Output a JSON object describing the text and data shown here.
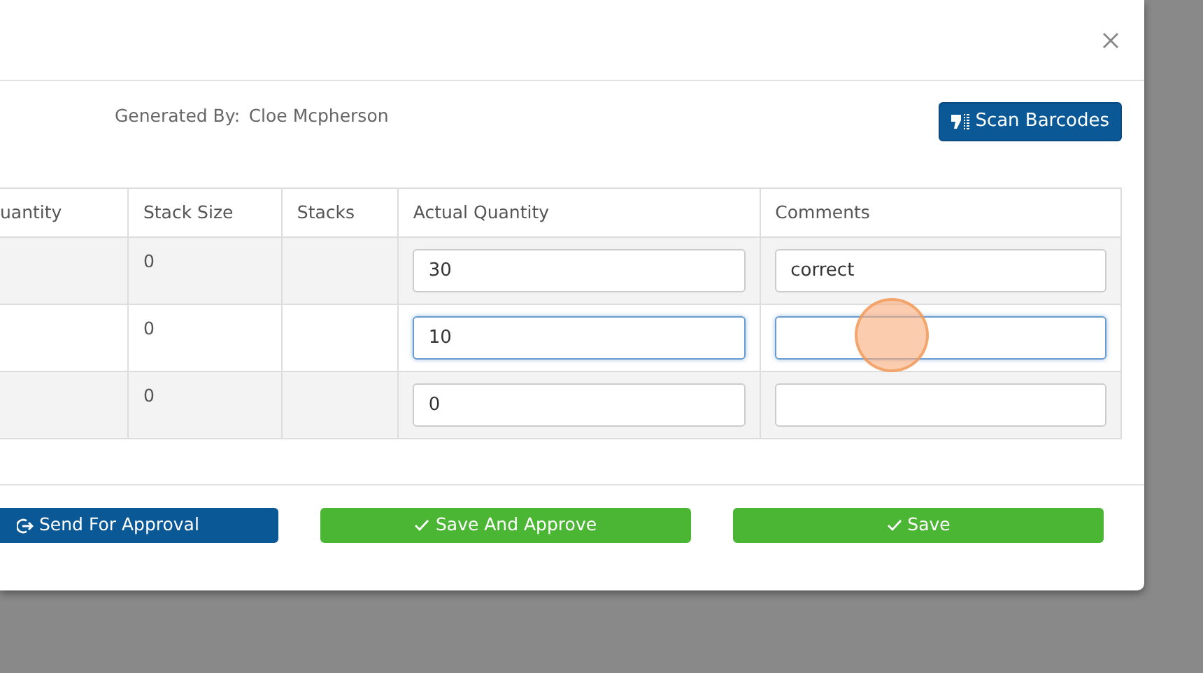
{
  "generated_by": {
    "label": "Generated By:",
    "value": "Cloe Mcpherson"
  },
  "scan_button": {
    "label": "Scan Barcodes"
  },
  "table": {
    "columns": [
      "uantity",
      "Stack Size",
      "Stacks",
      "Actual Quantity",
      "Comments"
    ],
    "rows": [
      {
        "stack_size": "0",
        "actual_quantity": {
          "value": "30",
          "focused": false
        },
        "comments": {
          "value": "correct",
          "focused": false
        }
      },
      {
        "stack_size": "0",
        "actual_quantity": {
          "value": "10",
          "focused": true
        },
        "comments": {
          "focused": true
        }
      },
      {
        "stack_size": "0",
        "actual_quantity": {
          "value": "0",
          "focused": false
        },
        "comments": {
          "focused": false
        }
      }
    ]
  },
  "buttons": [
    {
      "label": "Send For Approval",
      "kind": "send"
    },
    {
      "label": "Save And Approve",
      "kind": "approve"
    },
    {
      "label": "Save",
      "kind": "approve"
    }
  ]
}
